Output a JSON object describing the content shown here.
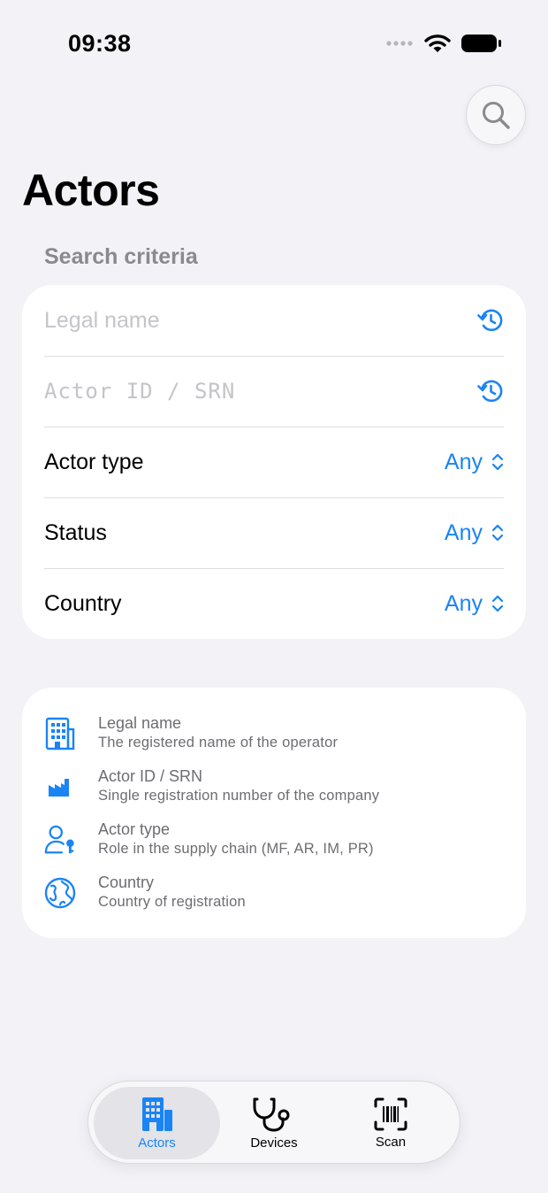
{
  "status_bar": {
    "time": "09:38"
  },
  "header": {
    "title": "Actors"
  },
  "search_criteria": {
    "section_title": "Search criteria",
    "legal_name_placeholder": "Legal name",
    "actor_id_placeholder": "Actor ID / SRN",
    "rows": [
      {
        "label": "Actor type",
        "value": "Any"
      },
      {
        "label": "Status",
        "value": "Any"
      },
      {
        "label": "Country",
        "value": "Any"
      }
    ]
  },
  "info": {
    "items": [
      {
        "title": "Legal name",
        "subtitle": "The registered name of the operator",
        "icon": "building-icon"
      },
      {
        "title": "Actor ID / SRN",
        "subtitle": "Single registration number of the company",
        "icon": "factory-icon"
      },
      {
        "title": "Actor type",
        "subtitle": "Role in the supply chain (MF, AR, IM, PR)",
        "icon": "person-key-icon"
      },
      {
        "title": "Country",
        "subtitle": "Country of registration",
        "icon": "globe-icon"
      }
    ]
  },
  "tabs": [
    {
      "label": "Actors",
      "icon": "building-icon",
      "selected": true
    },
    {
      "label": "Devices",
      "icon": "stethoscope-icon",
      "selected": false
    },
    {
      "label": "Scan",
      "icon": "barcode-scan-icon",
      "selected": false
    }
  ],
  "colors": {
    "accent": "#1a84f5",
    "background": "#f2f2f7",
    "card": "#ffffff",
    "secondary_text": "#6d6d72"
  }
}
